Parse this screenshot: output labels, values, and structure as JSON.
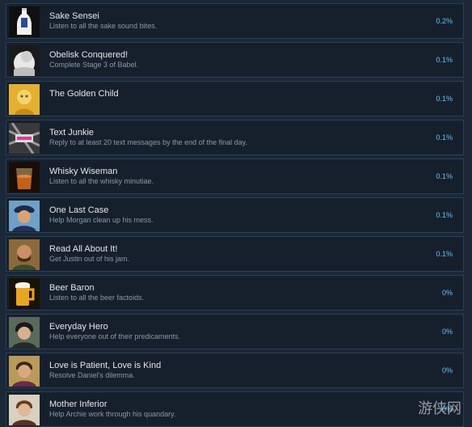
{
  "achievements": [
    {
      "title": "Sake Sensei",
      "desc": "Listen to all the sake sound bites.",
      "pct": "0.2%",
      "icon": "sake-bottle-icon"
    },
    {
      "title": "Obelisk Conquered!",
      "desc": "Complete Stage 3 of Babel.",
      "pct": "0.1%",
      "icon": "obelisk-icon"
    },
    {
      "title": "The Golden Child",
      "desc": "",
      "pct": "0.1%",
      "icon": "golden-child-icon"
    },
    {
      "title": "Text Junkie",
      "desc": "Reply to at least 20 text messages by the end of the final day.",
      "pct": "0.1%",
      "icon": "text-junkie-icon"
    },
    {
      "title": "Whisky Wiseman",
      "desc": "Listen to all the whisky minutiae.",
      "pct": "0.1%",
      "icon": "whisky-glass-icon"
    },
    {
      "title": "One Last Case",
      "desc": "Help Morgan clean up his mess.",
      "pct": "0.1%",
      "icon": "policeman-portrait-icon"
    },
    {
      "title": "Read All About It!",
      "desc": "Get Justin out of his jam.",
      "pct": "0.1%",
      "icon": "bearded-man-portrait-icon"
    },
    {
      "title": "Beer Baron",
      "desc": "Listen to all the beer factoids.",
      "pct": "0%",
      "icon": "beer-mug-icon"
    },
    {
      "title": "Everyday Hero",
      "desc": "Help everyone out of their predicaments.",
      "pct": "0%",
      "icon": "hero-portrait-icon"
    },
    {
      "title": "Love is Patient, Love is Kind",
      "desc": "Resolve Daniel's dilemma.",
      "pct": "0%",
      "icon": "daniel-portrait-icon"
    },
    {
      "title": "Mother Inferior",
      "desc": "Help Archie work through his quandary.",
      "pct": "0%",
      "icon": "archie-portrait-icon"
    }
  ],
  "watermark_text": "游侠网",
  "colors": {
    "background": "#1b2838",
    "row": "#16202d",
    "border": "#2a3f55",
    "title": "#e6e6e6",
    "description": "#8b98a6",
    "percent": "#66c0f4"
  }
}
